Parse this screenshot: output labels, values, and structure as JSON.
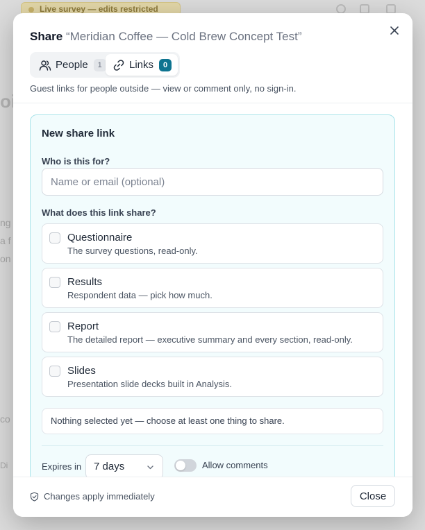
{
  "background": {
    "banner": "Live survey — edits restricted",
    "snippets": [
      "oi",
      "ng",
      "a f",
      "on",
      "co",
      "Di"
    ]
  },
  "dialog": {
    "title_prefix": "Share",
    "project_name": "“Meridian Coffee — Cold Brew Concept Test”",
    "tabs": [
      {
        "label": "People",
        "count": "1",
        "icon": "people-icon",
        "active": false
      },
      {
        "label": "Links",
        "count": "0",
        "icon": "link-icon",
        "active": true
      }
    ],
    "subtitle": "Guest links for people outside — view or comment only, no sign-in.",
    "new_link": {
      "title": "New share link",
      "recipient_label": "Who is this for?",
      "recipient_placeholder": "Name or email (optional)",
      "recipient_value": "",
      "share_label": "What does this link share?",
      "options": [
        {
          "title": "Questionnaire",
          "description": "The survey questions, read-only.",
          "checked": false
        },
        {
          "title": "Results",
          "description": "Respondent data — pick how much.",
          "checked": false
        },
        {
          "title": "Report",
          "description": "The detailed report — executive summary and every section, read-only.",
          "checked": false
        },
        {
          "title": "Slides",
          "description": "Presentation slide decks built in Analysis.",
          "checked": false
        }
      ],
      "notice": "Nothing selected yet — choose at least one thing to share.",
      "expires_label": "Expires in",
      "expires_value": "7 days",
      "allow_comments_label": "Allow comments",
      "allow_comments_on": false
    },
    "footer": {
      "status": "Changes apply immediately",
      "close_label": "Close"
    }
  },
  "colors": {
    "accent": "#0e7490",
    "panel_bg": "#f2fcfd",
    "panel_border": "#a9e3ea"
  }
}
